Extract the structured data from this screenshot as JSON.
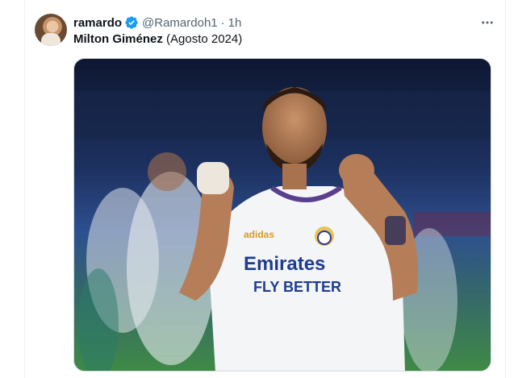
{
  "tweet": {
    "author_name": "ramardo",
    "handle": "@Ramardoh1",
    "separator": "·",
    "timestamp": "1h",
    "text_bold": "Milton Giménez",
    "text_rest": " (Agosto 2024)",
    "more_icon": "more-horizontal-icon",
    "verified_icon": "verified-badge-icon"
  },
  "media": {
    "jersey_brand": "Emirates",
    "jersey_slogan": "FLY BETTER",
    "sponsor": "adidas"
  },
  "colors": {
    "verified": "#1d9bf0",
    "text_primary": "#0f1419",
    "text_secondary": "#536471",
    "border": "#cfd9de"
  }
}
